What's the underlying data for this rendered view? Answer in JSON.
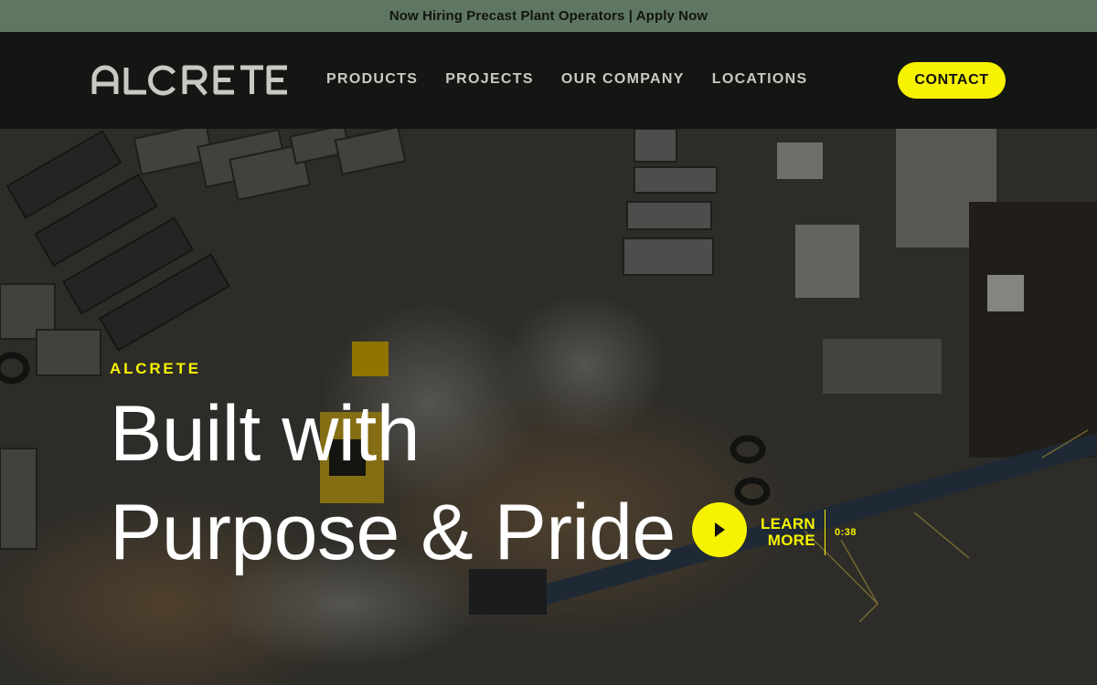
{
  "announcement": {
    "text": "Now Hiring Precast Plant Operators | Apply Now"
  },
  "header": {
    "logo_text": "ALCRETE",
    "nav": [
      {
        "label": "PRODUCTS"
      },
      {
        "label": "PROJECTS"
      },
      {
        "label": "OUR COMPANY"
      },
      {
        "label": "LOCATIONS"
      }
    ],
    "contact_label": "CONTACT"
  },
  "hero": {
    "eyebrow": "ALCRETE",
    "headline_line1": "Built with",
    "headline_line2": "Purpose & Pride",
    "video": {
      "learn_more": "LEARN MORE",
      "learn_line1": "LEARN",
      "learn_line2": "MORE",
      "duration": "0:38"
    }
  },
  "colors": {
    "accent": "#f6f200",
    "announcement_bg": "#5f7762",
    "nav_bg": "#141613",
    "nav_text": "#c9c9c4",
    "headline": "#ffffff"
  },
  "icons": {
    "play": "play-icon"
  }
}
